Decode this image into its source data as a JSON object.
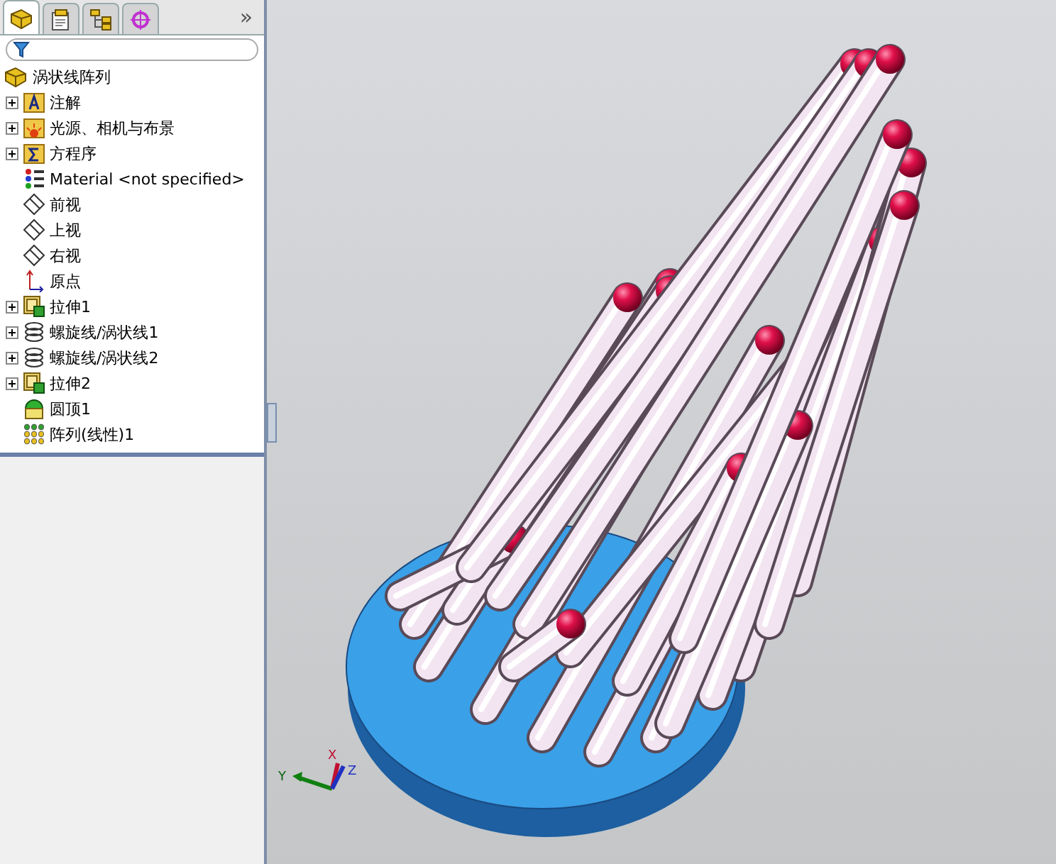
{
  "tabs": [
    {
      "kind": "feature",
      "selected": true
    },
    {
      "kind": "property",
      "selected": false
    },
    {
      "kind": "config",
      "selected": false
    },
    {
      "kind": "display",
      "selected": false
    }
  ],
  "overflow": "»",
  "root": {
    "label": "涡状线阵列"
  },
  "tree": [
    {
      "kind": "annotation",
      "label": "注解",
      "expandable": true
    },
    {
      "kind": "lights",
      "label": "光源、相机与布景",
      "expandable": true
    },
    {
      "kind": "equation",
      "label": "方程序",
      "expandable": true
    },
    {
      "kind": "material",
      "label": "Material <not specified>",
      "expandable": false
    },
    {
      "kind": "plane",
      "label": "前视",
      "expandable": false
    },
    {
      "kind": "plane",
      "label": "上视",
      "expandable": false
    },
    {
      "kind": "plane",
      "label": "右视",
      "expandable": false
    },
    {
      "kind": "origin",
      "label": "原点",
      "expandable": false
    },
    {
      "kind": "extrude",
      "label": "拉伸1",
      "expandable": true
    },
    {
      "kind": "helix",
      "label": "螺旋线/涡状线1",
      "expandable": true
    },
    {
      "kind": "helix",
      "label": "螺旋线/涡状线2",
      "expandable": true
    },
    {
      "kind": "extrude",
      "label": "拉伸2",
      "expandable": true
    },
    {
      "kind": "dome",
      "label": "圆顶1",
      "expandable": false
    },
    {
      "kind": "pattern",
      "label": "阵列(线性)1",
      "expandable": false
    }
  ],
  "triad": {
    "y_label": "Y",
    "x_label": "X",
    "z_label": "Z"
  }
}
